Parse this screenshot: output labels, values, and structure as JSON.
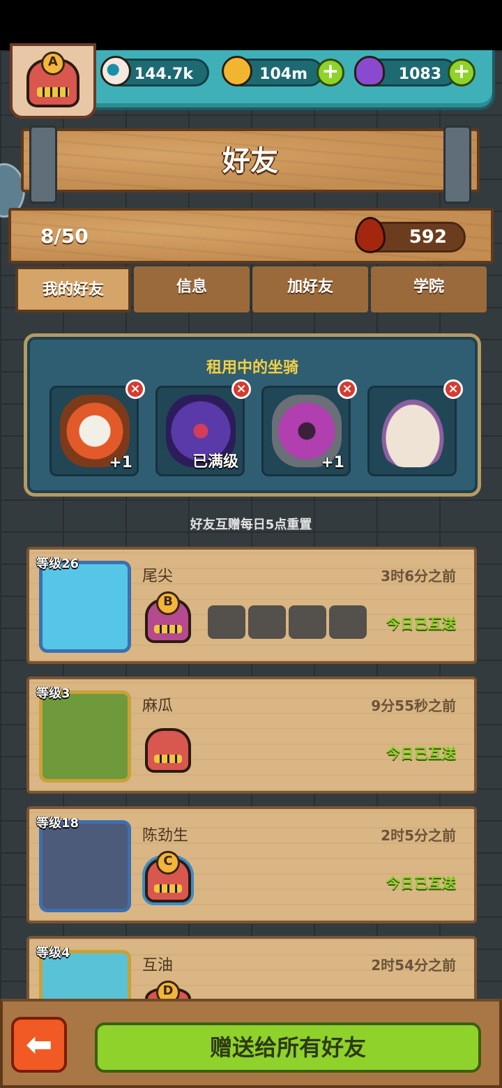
{
  "status_bar": {},
  "resources": {
    "eyes": "144.7k",
    "coins": "104m",
    "potion": "1083"
  },
  "player": {
    "grade": "A"
  },
  "header": {
    "title": "好友"
  },
  "info": {
    "friend_count": "8/50",
    "blood": "592"
  },
  "tabs": [
    {
      "label": "我的好友",
      "active": true
    },
    {
      "label": "信息",
      "active": false
    },
    {
      "label": "加好友",
      "active": false
    },
    {
      "label": "学院",
      "active": false
    }
  ],
  "rental": {
    "title": "租用中的坐骑",
    "slots": [
      {
        "tag": "+1",
        "icon": "lion-dance-mount-icon"
      },
      {
        "tag": "已满级",
        "icon": "rose-mount-icon"
      },
      {
        "tag": "+1",
        "icon": "horned-demon-mount-icon"
      },
      {
        "tag": "",
        "icon": "rabbit-mount-icon"
      }
    ]
  },
  "reset_note": "好友互赠每日5点重置",
  "friends": [
    {
      "level": "等级26",
      "name": "尾尖",
      "time": "3时6分之前",
      "sent": "今日已互送",
      "grade": "B"
    },
    {
      "level": "等级3",
      "name": "麻瓜",
      "time": "9分55秒之前",
      "sent": "今日已互送",
      "grade": ""
    },
    {
      "level": "等级18",
      "name": "陈劲生",
      "time": "2时5分之前",
      "sent": "今日已互送",
      "grade": "C"
    },
    {
      "level": "等级4",
      "name": "互油",
      "time": "2时54分之前",
      "sent": "",
      "grade": "D"
    }
  ],
  "bottom": {
    "back_icon": "arrow-left-icon",
    "gift_all": "赠送给所有好友"
  }
}
